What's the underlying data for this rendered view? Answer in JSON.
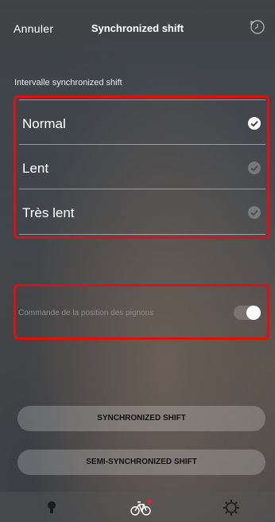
{
  "header": {
    "cancel_label": "Annuler",
    "title": "Synchronized shift",
    "history_icon": "history-clock-icon"
  },
  "interval": {
    "section_label": "Intervalle synchronized shift",
    "options": [
      {
        "label": "Normal",
        "selected": true
      },
      {
        "label": "Lent",
        "selected": false
      },
      {
        "label": "Très lent",
        "selected": false
      }
    ]
  },
  "sprocket_control": {
    "label": "Commande de la position des pignons",
    "enabled": true
  },
  "buttons": {
    "synchronized": "SYNCHRONIZED SHIFT",
    "semi_synchronized": "SEMI-SYNCHRONIZED SHIFT"
  },
  "tabbar": {
    "items": [
      "lightbulb-icon",
      "bicycle-icon",
      "gear-icon"
    ],
    "active": "bicycle-icon",
    "notification_color": "#e0202a"
  },
  "colors": {
    "highlight": "#e01010",
    "check_on": "#ffffff"
  }
}
